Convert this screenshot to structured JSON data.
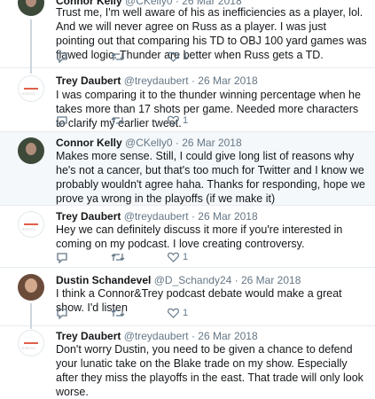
{
  "tweets": [
    {
      "name": "Connor Kelly",
      "handle": "@CKelly0",
      "date": "26 Mar 2018",
      "text": "Trust me, I'm well aware of his as inefficiencies as a player, lol. And we will never agree on Russ as a player. I was just pointing out that comparing his TD to OBJ 100 yard games was flawed logic. Thunder are better when Russ gets a TD.",
      "replies": "",
      "retweets": "",
      "likes": "1",
      "highlighted": false
    },
    {
      "name": "Trey Daubert",
      "handle": "@treydaubert",
      "date": "26 Mar 2018",
      "text": "I was comparing it to the thunder winning percentage when he takes more than 17 shots per game. Needed more characters to clarify my earlier tweet.",
      "replies": "",
      "retweets": "",
      "likes": "1",
      "highlighted": false
    },
    {
      "name": "Connor Kelly",
      "handle": "@CKelly0",
      "date": "26 Mar 2018",
      "text": "Makes more sense. Still, I could give long list of reasons why he's not a cancer, but that's too much for Twitter and I know we probably wouldn't agree haha. Thanks for responding, hope we prove ya wrong in the playoffs (if we make it)",
      "replies": "",
      "retweets": "",
      "likes": "",
      "highlighted": true
    },
    {
      "name": "Trey Daubert",
      "handle": "@treydaubert",
      "date": "26 Mar 2018",
      "text": "Hey we can definitely discuss it more if you're interested in coming on my podcast. I love creating controversy.",
      "replies": "",
      "retweets": "",
      "likes": "1",
      "highlighted": false
    },
    {
      "name": "Dustin Schandevel",
      "handle": "@D_Schandy24",
      "date": "26 Mar 2018",
      "text": "I think a Connor&Trey podcast debate would make a great show. I'd listen",
      "replies": "",
      "retweets": "",
      "likes": "1",
      "highlighted": false
    },
    {
      "name": "Trey Daubert",
      "handle": "@treydaubert",
      "date": "26 Mar 2018",
      "text": "Don't worry Dustin, you need to be given a chance to defend your lunatic take on the Blake trade on my show. Especially after they miss the playoffs in the east.  That trade will only look worse.",
      "replies": "",
      "retweets": "",
      "likes": "",
      "highlighted": false
    }
  ],
  "separator": "·",
  "colors": {
    "text": "#14171a",
    "meta": "#657786",
    "border": "#e6ecf0",
    "highlight_bg": "#f5f8fa",
    "thread_line": "#ccd6dd"
  }
}
